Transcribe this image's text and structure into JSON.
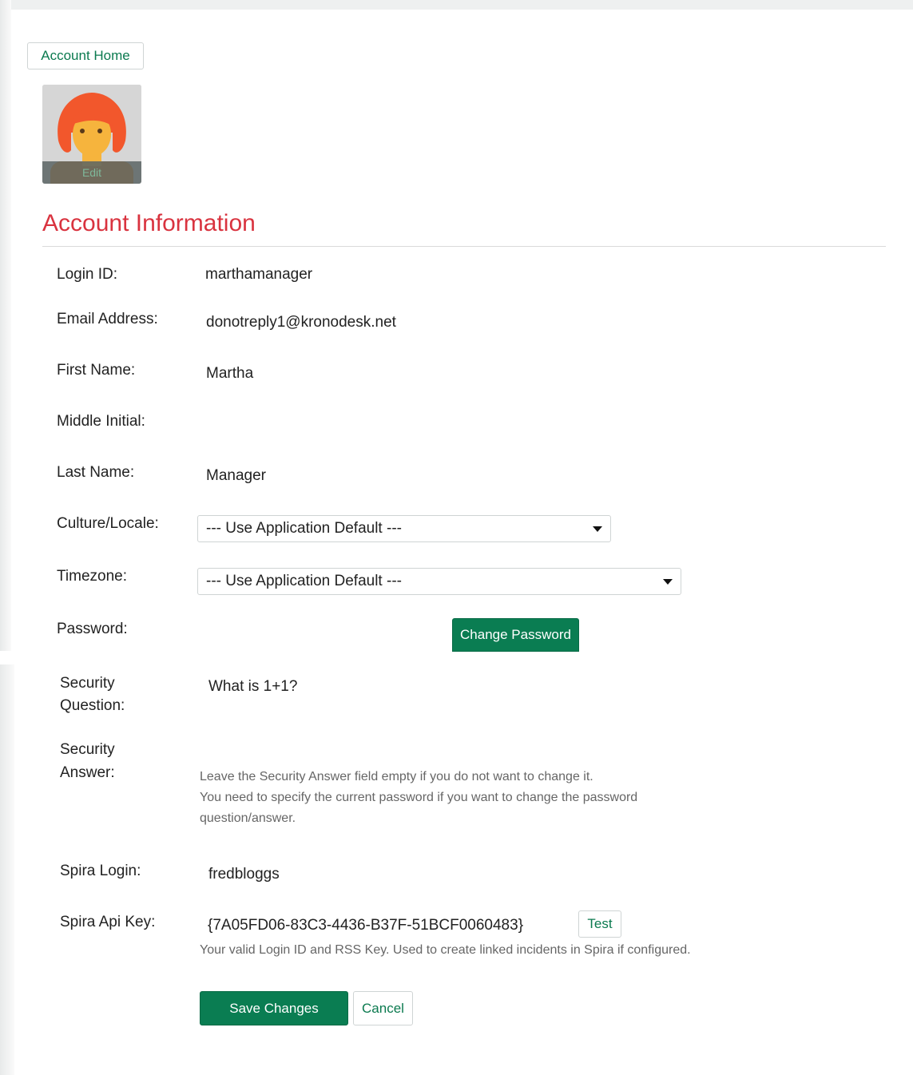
{
  "nav": {
    "account_home": "Account Home"
  },
  "avatar": {
    "edit_label": "Edit"
  },
  "section": {
    "title": "Account Information"
  },
  "fields": {
    "login_id": {
      "label": "Login ID:",
      "value": "marthamanager"
    },
    "email": {
      "label": "Email Address:",
      "value": "donotreply1@kronodesk.net"
    },
    "first_name": {
      "label": "First Name:",
      "value": "Martha"
    },
    "middle_initial": {
      "label": "Middle Initial:",
      "value": ""
    },
    "last_name": {
      "label": "Last Name:",
      "value": "Manager"
    },
    "culture": {
      "label": "Culture/Locale:",
      "selected": "--- Use Application Default ---"
    },
    "timezone": {
      "label": "Timezone:",
      "selected": "--- Use Application Default ---"
    },
    "password": {
      "label": "Password:",
      "button": "Change Password"
    },
    "security_question": {
      "label_line1": "Security",
      "label_line2": "Question:",
      "value": "What is 1+1?"
    },
    "security_answer": {
      "label_line1": "Security",
      "label_line2": "Answer:",
      "help_line1": "Leave the Security Answer field empty if you do not want to change it.",
      "help_line2": "You need to specify the current password if you want to change the password",
      "help_line3": "question/answer."
    },
    "spira_login": {
      "label": "Spira Login:",
      "value": "fredbloggs"
    },
    "spira_api_key": {
      "label": "Spira Api Key:",
      "value": "{7A05FD06-83C3-4436-B37F-51BCF0060483}",
      "test_button": "Test",
      "help": "Your valid Login ID and RSS Key. Used to create linked incidents in Spira if configured."
    }
  },
  "actions": {
    "save": "Save Changes",
    "cancel": "Cancel"
  },
  "colors": {
    "accent": "#0a7d52",
    "heading": "#d9333f",
    "help_text": "#666666"
  }
}
